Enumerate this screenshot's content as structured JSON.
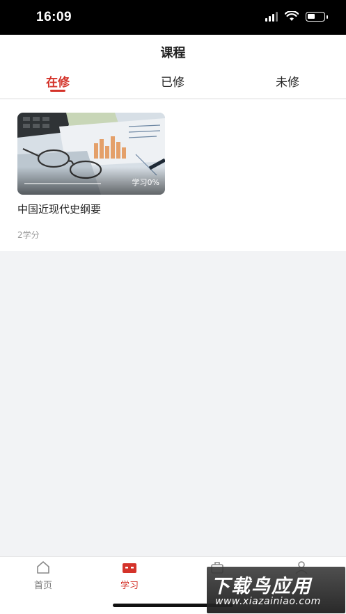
{
  "status_bar": {
    "time": "16:09"
  },
  "header": {
    "title": "课程"
  },
  "tabs": [
    {
      "label": "在修",
      "active": true
    },
    {
      "label": "已修",
      "active": false
    },
    {
      "label": "未修",
      "active": false
    }
  ],
  "courses": [
    {
      "title": "中国近现代史纲要",
      "progress_label": "学习0%",
      "progress": 0,
      "credits": "2学分"
    }
  ],
  "bottom_nav": [
    {
      "label": "首页",
      "icon": "home-icon",
      "active": false
    },
    {
      "label": "学习",
      "icon": "study-icon",
      "active": true
    },
    {
      "label": "",
      "icon": "briefcase-icon",
      "active": false
    },
    {
      "label": "",
      "icon": "user-icon",
      "active": false
    }
  ],
  "watermark": {
    "main": "下载鸟应用",
    "sub": "www.xiazainiao.com"
  },
  "colors": {
    "accent": "#d4332a",
    "background": "#f2f3f5"
  }
}
